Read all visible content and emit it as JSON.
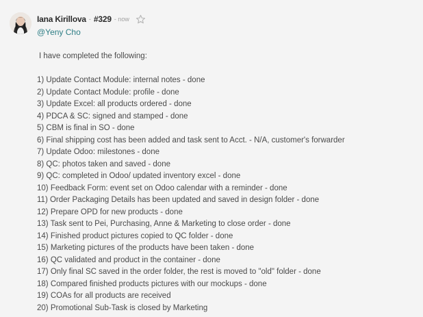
{
  "message": {
    "author": "Iana Kirillova",
    "separator": "-",
    "id": "#329",
    "time": "- now",
    "mention": "@Yeny Cho",
    "intro": "I have completed the following:",
    "items": [
      "1) Update Contact Module: internal notes - done",
      "2) Update Contact Module: profile - done",
      "3) Update Excel: all products ordered - done",
      "4) PDCA & SC: signed and stamped - done",
      "5) CBM is final in SO - done",
      "6) Final shipping cost has been added and task sent to Acct. - N/A, customer's forwarder",
      "7) Update Odoo: milestones - done",
      "8) QC: photos taken and saved - done",
      "9) QC: completed in Odoo/ updated inventory excel - done",
      "10) Feedback Form: event set on Odoo calendar with a reminder - done",
      "11) Order Packaging Details has been updated and saved in design folder - done",
      "12) Prepare OPD for new products - done",
      "13) Task sent to Pei, Purchasing, Anne & Marketing to close order - done",
      "14) Finished product pictures copied to QC folder - done",
      "15) Marketing pictures of the products have been taken - done",
      "16) QC validated and product in the container - done",
      "17) Only final SC saved in the order folder, the rest is moved to \"old\" folder - done",
      "18) Compared finished products pictures with our mockups - done",
      "19) COAs for all products are received",
      "20) Promotional Sub-Task is closed by Marketing"
    ],
    "icons": {
      "avatar": "user-avatar-photo",
      "star": "star-outline-icon"
    }
  },
  "colors": {
    "background": "#f4f4f4",
    "text": "#4a4a4a",
    "author": "#2b2b2b",
    "mention": "#2e7e85",
    "muted": "#a0a0a0"
  }
}
